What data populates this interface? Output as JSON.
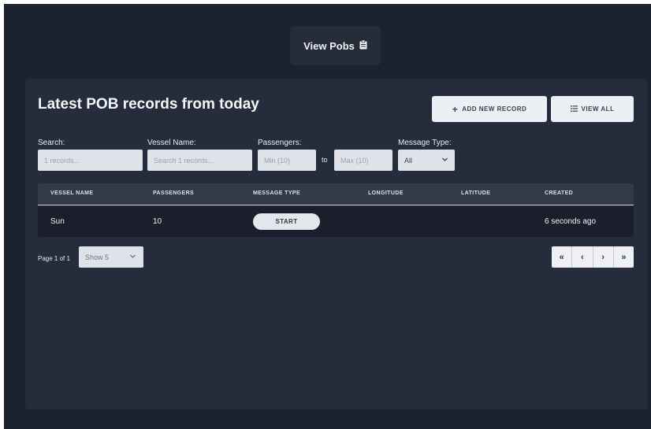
{
  "top_button": {
    "label": "View Pobs",
    "icon": "clipboard-icon"
  },
  "panel": {
    "title": "Latest POB records from today",
    "add_button": "ADD NEW RECORD",
    "view_all_button": "VIEW ALL"
  },
  "filters": {
    "search": {
      "label": "Search:",
      "placeholder": "1 records..."
    },
    "vessel": {
      "label": "Vessel Name:",
      "placeholder": "Search 1 records..."
    },
    "passengers": {
      "label": "Passengers:",
      "min_placeholder": "Min (10)",
      "to": "to",
      "max_placeholder": "Max (10)"
    },
    "message_type": {
      "label": "Message Type:",
      "value": "All"
    }
  },
  "table": {
    "headers": [
      "VESSEL NAME",
      "PASSENGERS",
      "MESSAGE TYPE",
      "LONGITUDE",
      "LATITUDE",
      "CREATED"
    ],
    "rows": [
      {
        "vessel": "Sun",
        "passengers": "10",
        "message_type": "START",
        "longitude": "",
        "latitude": "",
        "created": "6 seconds ago"
      }
    ]
  },
  "pagination": {
    "page_info": "Page 1 of 1",
    "show": "Show 5",
    "first": "«",
    "prev": "‹",
    "next": "›",
    "last": "»"
  },
  "colors": {
    "background": "#1c2230",
    "panel": "#252c3b",
    "row": "#1a1f2b"
  }
}
